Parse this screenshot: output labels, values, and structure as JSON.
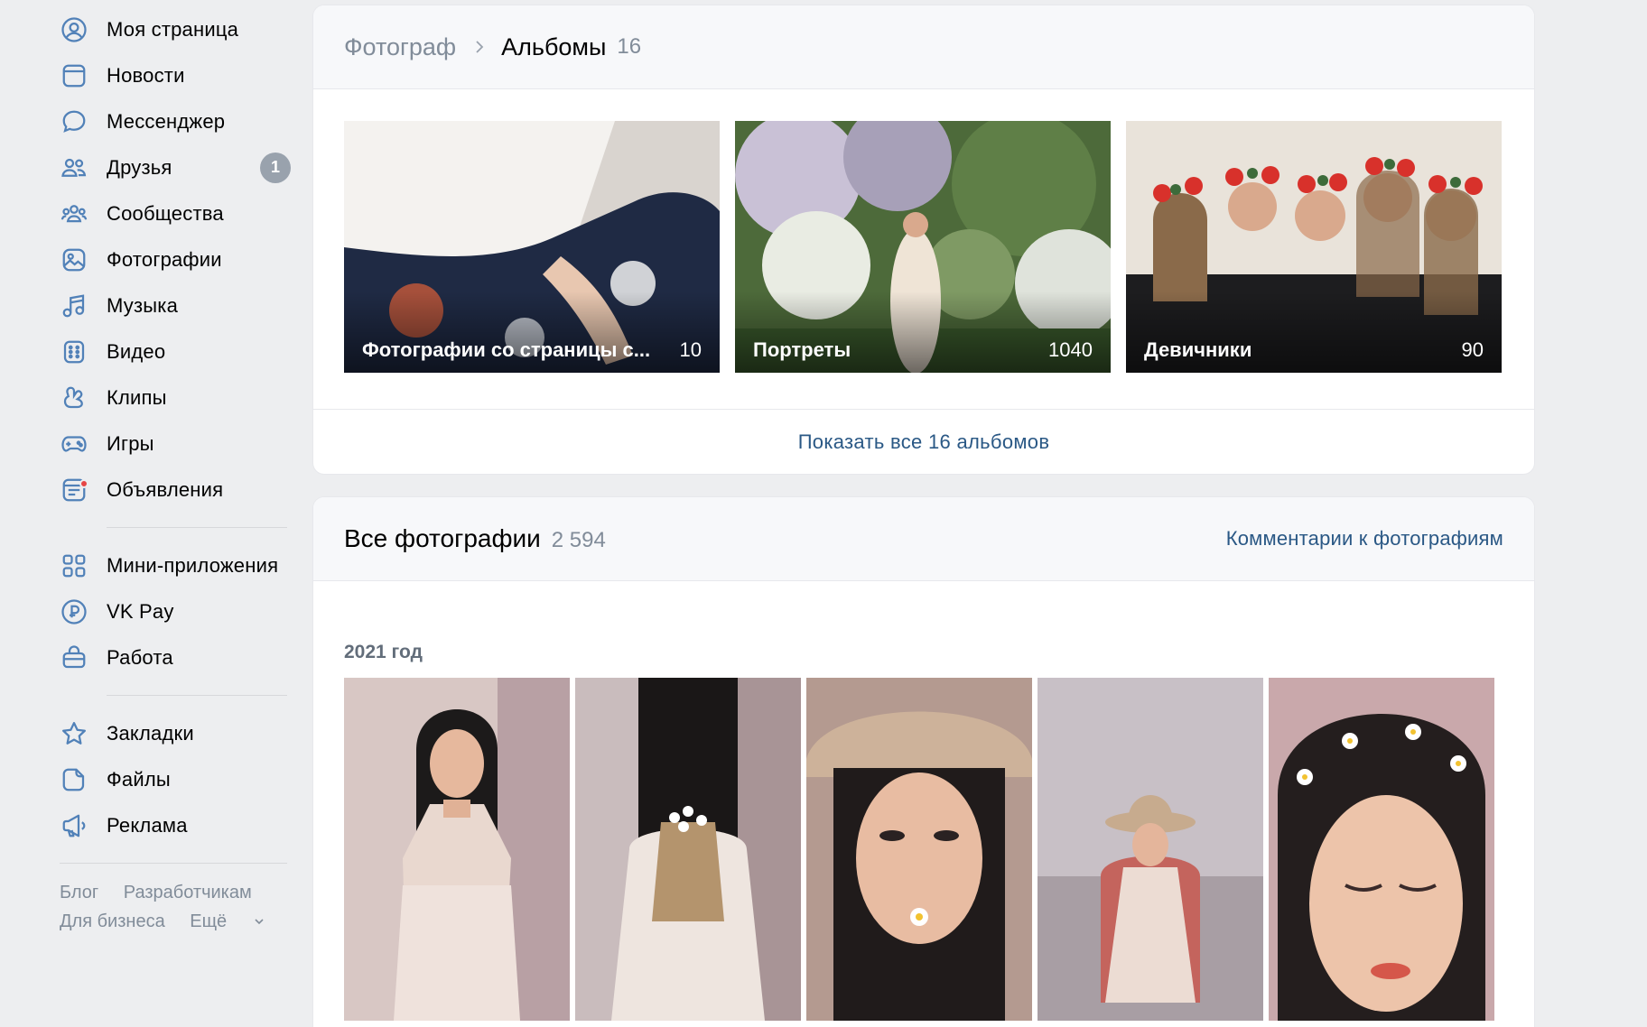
{
  "sidebar": {
    "items": [
      {
        "label": "Моя страница",
        "icon": "user-circle-icon"
      },
      {
        "label": "Новости",
        "icon": "news-icon"
      },
      {
        "label": "Мессенджер",
        "icon": "message-icon"
      },
      {
        "label": "Друзья",
        "icon": "friends-icon",
        "badge": "1"
      },
      {
        "label": "Сообщества",
        "icon": "communities-icon"
      },
      {
        "label": "Фотографии",
        "icon": "photo-icon"
      },
      {
        "label": "Музыка",
        "icon": "music-icon"
      },
      {
        "label": "Видео",
        "icon": "video-icon"
      },
      {
        "label": "Клипы",
        "icon": "clips-icon"
      },
      {
        "label": "Игры",
        "icon": "gamepad-icon"
      },
      {
        "label": "Объявления",
        "icon": "classifieds-icon"
      }
    ],
    "items2": [
      {
        "label": "Мини-приложения",
        "icon": "apps-icon"
      },
      {
        "label": "VK Pay",
        "icon": "vkpay-icon"
      },
      {
        "label": "Работа",
        "icon": "work-icon"
      }
    ],
    "items3": [
      {
        "label": "Закладки",
        "icon": "star-icon"
      },
      {
        "label": "Файлы",
        "icon": "file-icon"
      },
      {
        "label": "Реклама",
        "icon": "megaphone-icon"
      }
    ],
    "footer": {
      "blog": "Блог",
      "developers": "Разработчикам",
      "business": "Для бизнеса",
      "more": "Ещё"
    }
  },
  "albums_section": {
    "breadcrumb_root": "Фотограф",
    "breadcrumb_current": "Альбомы",
    "count": "16",
    "albums": [
      {
        "title": "Фотографии со страницы с...",
        "count": "10"
      },
      {
        "title": "Портреты",
        "count": "1040"
      },
      {
        "title": "Девичники",
        "count": "90"
      }
    ],
    "show_all": "Показать все 16 альбомов"
  },
  "photos_section": {
    "title": "Все фотографии",
    "count": "2 594",
    "comments_link": "Комментарии к фотографиям",
    "year": "2021 год"
  },
  "colors": {
    "accent": "#5181b8",
    "link": "#2a5885",
    "background": "#edeef0",
    "badge": "#99a2ad",
    "notification": "#e64646"
  }
}
